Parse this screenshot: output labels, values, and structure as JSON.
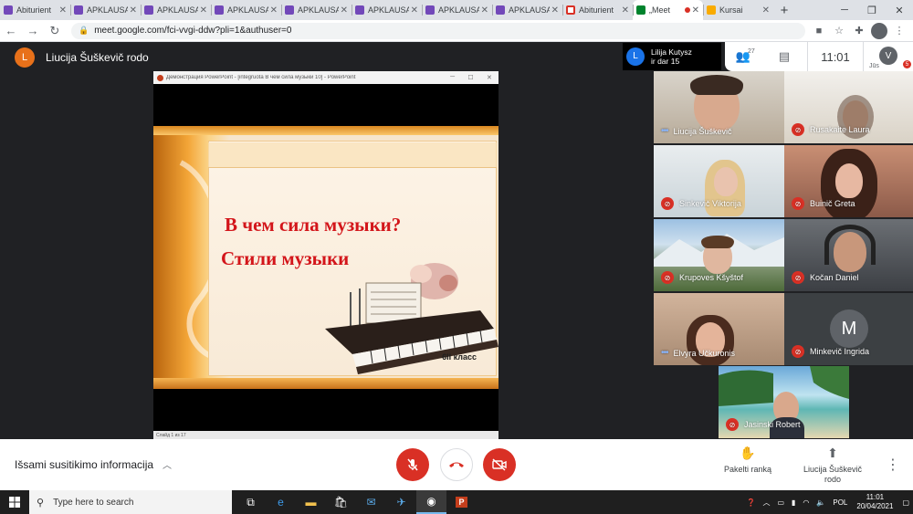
{
  "browser": {
    "tabs": [
      {
        "title": "Abiturient",
        "color": "#7248b9"
      },
      {
        "title": "APKLAUSA",
        "color": "#7248b9"
      },
      {
        "title": "APKLAUSA",
        "color": "#7248b9"
      },
      {
        "title": "APKLAUSA",
        "color": "#7248b9"
      },
      {
        "title": "APKLAUSA",
        "color": "#7248b9"
      },
      {
        "title": "APKLAUSA",
        "color": "#7248b9"
      },
      {
        "title": "APKLAUSA",
        "color": "#7248b9"
      },
      {
        "title": "APKLAUSA",
        "color": "#7248b9"
      },
      {
        "title": "Abiturient",
        "color": "#d93025"
      },
      {
        "title": "„Meet",
        "color": "#00832d"
      },
      {
        "title": "Kursai",
        "color": "#f9ab00"
      }
    ],
    "url": "meet.google.com/fci-vvgi-ddw?pli=1&authuser=0",
    "profile_initial": "V"
  },
  "meet": {
    "presenter": {
      "initial": "L",
      "name": "Liucija Šuškevič rodo"
    },
    "pinned": {
      "initial": "L",
      "line1": "Lilija Kutysz",
      "line2": "ir dar 15"
    },
    "participants_count": "27",
    "time": "11:01",
    "you": {
      "initial": "V",
      "label": "Jūs",
      "badge": "5"
    },
    "tiles": [
      {
        "name": "Liucija Šuškevič",
        "state": "talking"
      },
      {
        "name": "Rusakaite Laura",
        "state": "muted"
      },
      {
        "name": "Sinkevič Viktorija",
        "state": "muted"
      },
      {
        "name": "Buinič Greta",
        "state": "muted"
      },
      {
        "name": "Krupoves Kšyštof",
        "state": "muted"
      },
      {
        "name": "Kočan Daniel",
        "state": "muted"
      },
      {
        "name": "Elvyra Učkuronis",
        "state": "talking"
      },
      {
        "name": "Minkevič Ingrida",
        "state": "muted",
        "initial": "M"
      },
      {
        "name": "Jasinski Robert",
        "state": "muted"
      }
    ],
    "bottom": {
      "meeting_info": "Išsami susitikimo informacija",
      "raise_hand": "Pakelti ranką",
      "presenter_line1": "Liucija Šuškevič",
      "presenter_line2": "rodo"
    }
  },
  "presentation": {
    "window_title": "Демонстрация PowerPoint - [integruota В чем сила музыки 10] - PowerPoint",
    "slide_title": "В чем сила музыки?",
    "slide_subtitle": "Стили музыки",
    "grade": "6II класс",
    "status": "Слайд 1 из 17"
  },
  "taskbar": {
    "search_placeholder": "Type here to search",
    "lang": "POL",
    "time": "11:01",
    "date": "20/04/2021"
  }
}
